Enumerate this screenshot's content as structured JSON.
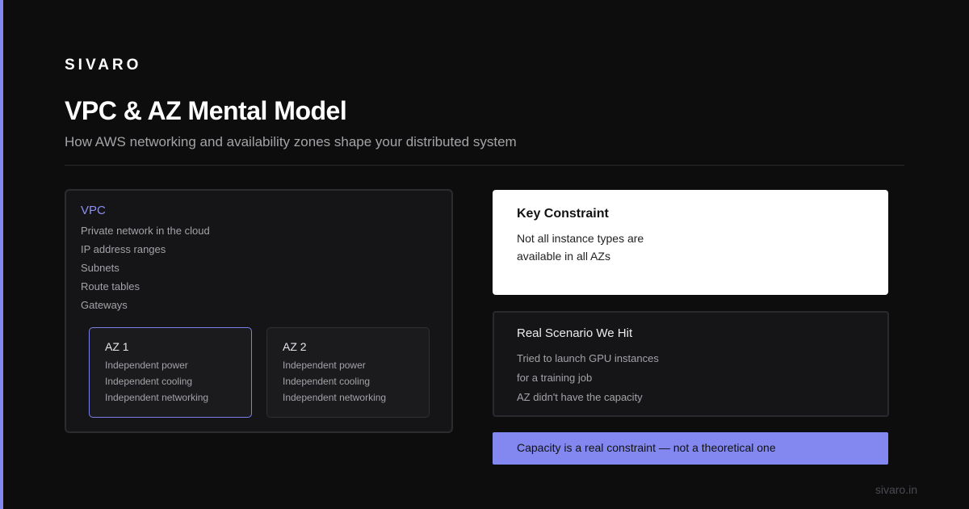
{
  "brand": "SIVARO",
  "header": {
    "title": "VPC & AZ Mental Model",
    "subtitle": "How AWS networking and availability zones shape your distributed system"
  },
  "vpc": {
    "title": "VPC",
    "items": [
      "Private network in the cloud",
      "IP address ranges",
      "Subnets",
      "Route tables",
      "Gateways"
    ],
    "azs": [
      {
        "title": "AZ 1",
        "items": [
          "Independent power",
          "Independent cooling",
          "Independent networking"
        ]
      },
      {
        "title": "AZ 2",
        "items": [
          "Independent power",
          "Independent cooling",
          "Independent networking"
        ]
      }
    ]
  },
  "key_constraint": {
    "title": "Key Constraint",
    "body": "Not all instance types are available in all AZs"
  },
  "scenario": {
    "title": "Real Scenario We Hit",
    "items": [
      "Tried to launch GPU instances",
      "for a training job",
      "AZ didn't have the capacity"
    ]
  },
  "callout": "Capacity is a real constraint — not a theoretical one",
  "footer": "sivaro.in",
  "colors": {
    "accent": "#8288f0",
    "background": "#0d0d0d",
    "card_dark": "#151517",
    "card_light": "#ffffff"
  }
}
